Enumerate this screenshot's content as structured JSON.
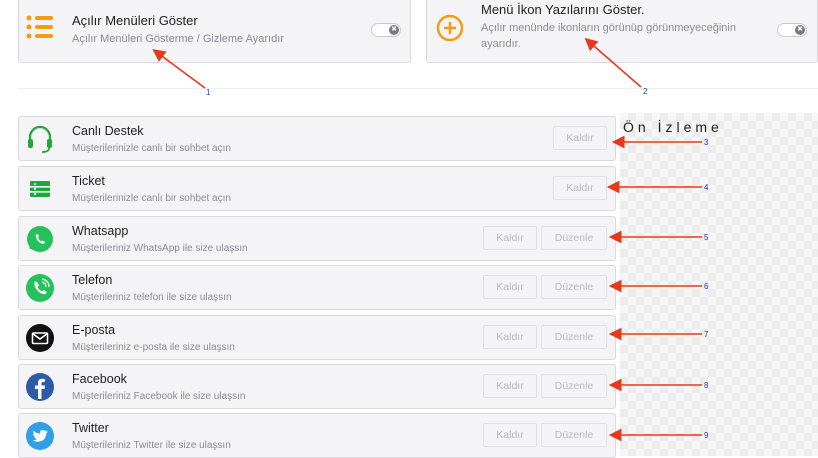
{
  "top": [
    {
      "title": "Açılır Menüleri Göster",
      "desc": "Açılır Menüleri Gösterme / Gizleme Ayarıdır",
      "marker": "1"
    },
    {
      "title": "Menü İkon Yazılarını Göster.",
      "desc": "Açılır menünde ikonların görünüp görünmeyeceğinin ayarıdır.",
      "marker": "2"
    }
  ],
  "preview_title": "Ön İzleme",
  "buttons": {
    "remove": "Kaldır",
    "edit": "Düzenle"
  },
  "items": [
    {
      "title": "Canlı Destek",
      "desc": "Müşterilerinizle canlı bir sohbet açın",
      "icon": "headset-icon",
      "color": "#1fa83a",
      "edit": false,
      "marker": "3"
    },
    {
      "title": "Ticket",
      "desc": "Müşterilerinizle canlı bir sohbet açın",
      "icon": "ticket-icon",
      "color": "#1fa83a",
      "edit": false,
      "marker": "4"
    },
    {
      "title": "Whatsapp",
      "desc": "Müşterileriniz WhatsApp ile size ulaşsın",
      "icon": "whatsapp-icon",
      "color": "#25c15a",
      "edit": true,
      "marker": "5"
    },
    {
      "title": "Telefon",
      "desc": "Müşterileriniz telefon ile size ulaşsın",
      "icon": "phone-icon",
      "color": "#25c15a",
      "edit": true,
      "marker": "6"
    },
    {
      "title": "E-posta",
      "desc": "Müşterileriniz e-posta ile size ulaşsın",
      "icon": "email-icon",
      "color": "#111111",
      "edit": true,
      "marker": "7"
    },
    {
      "title": "Facebook",
      "desc": "Müşterileriniz Facebook ile size ulaşsın",
      "icon": "facebook-icon",
      "color": "#2d5ba8",
      "edit": true,
      "marker": "8"
    },
    {
      "title": "Twitter",
      "desc": "Müşterileriniz Twitter ile size ulaşsın",
      "icon": "twitter-icon",
      "color": "#2f9fe6",
      "edit": true,
      "marker": "9"
    }
  ],
  "colors": {
    "accent_orange": "#f39c12",
    "arrow": "#e8381a",
    "marker": "#1a3fb8"
  }
}
